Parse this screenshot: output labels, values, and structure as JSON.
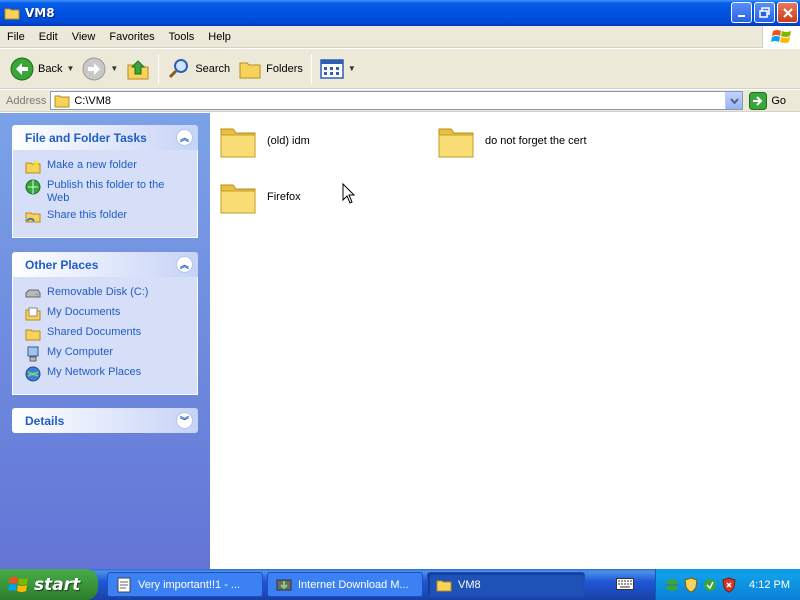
{
  "window": {
    "title": "VM8"
  },
  "menu": [
    "File",
    "Edit",
    "View",
    "Favorites",
    "Tools",
    "Help"
  ],
  "toolbar": {
    "back": "Back",
    "search": "Search",
    "folders": "Folders"
  },
  "address": {
    "label": "Address",
    "value": "C:\\VM8",
    "go": "Go"
  },
  "file_tasks": {
    "title": "File and Folder Tasks",
    "items": [
      "Make a new folder",
      "Publish this folder to the Web",
      "Share this folder"
    ]
  },
  "other_places": {
    "title": "Other Places",
    "items": [
      "Removable Disk (C:)",
      "My Documents",
      "Shared Documents",
      "My Computer",
      "My Network Places"
    ]
  },
  "details": {
    "title": "Details"
  },
  "folders": [
    "(old) idm",
    "do not forget the cert",
    "Firefox"
  ],
  "taskbar": {
    "start": "start",
    "tasks": [
      "Very important!!1 - ...",
      "Internet Download M...",
      "VM8"
    ],
    "clock": "4:12 PM"
  },
  "colors": {
    "title_blue": "#0055e5",
    "link_blue": "#215dc6",
    "pane_blue": "#7ba2e7",
    "start_green": "#3c9b3c"
  }
}
